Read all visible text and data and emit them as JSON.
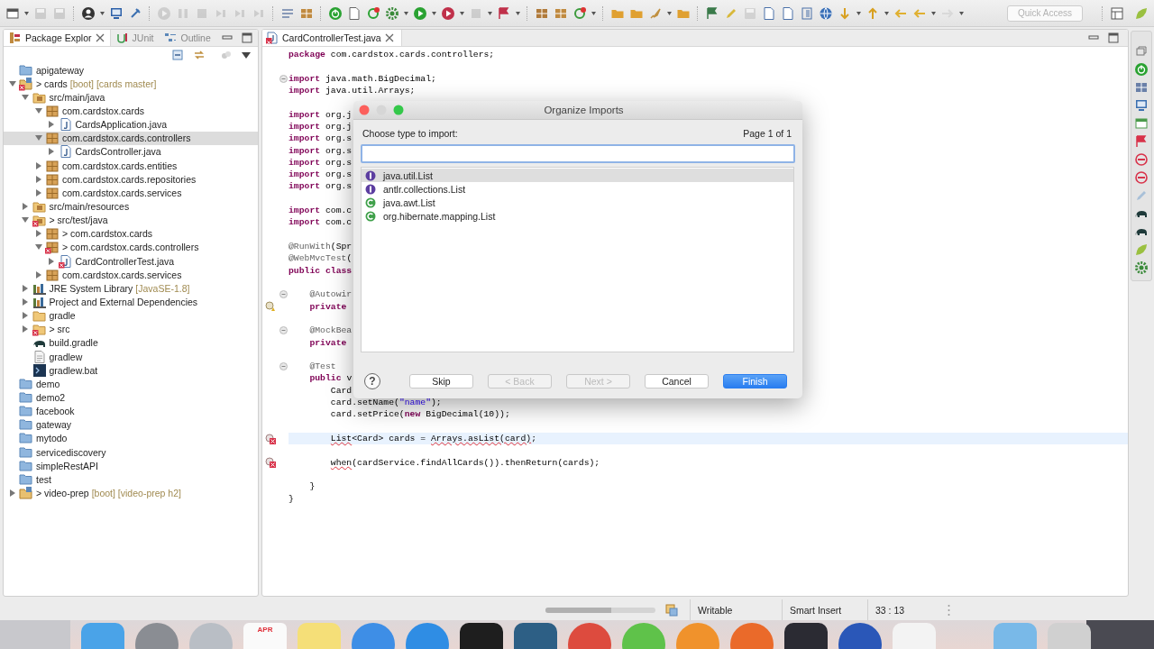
{
  "toolbar": {
    "quick_access": {
      "placeholder": "Quick Access"
    }
  },
  "explorer": {
    "tabs": [
      {
        "label": "Package Explor",
        "kind": "package",
        "selected": true
      },
      {
        "label": "JUnit",
        "kind": "junit",
        "selected": false
      },
      {
        "label": "Outline",
        "kind": "outline",
        "selected": false
      }
    ],
    "tree": [
      {
        "label": "apigateway",
        "kind": "closed-project",
        "selected": false,
        "error": false
      },
      {
        "label": "> cards",
        "suffix": "[boot] [cards master]",
        "kind": "project",
        "expanded": true,
        "selected": false,
        "error": true,
        "children": [
          {
            "label": "src/main/java",
            "kind": "source-folder",
            "expanded": true,
            "selected": false,
            "error": false,
            "children": [
              {
                "label": "com.cardstox.cards",
                "kind": "package",
                "expanded": true,
                "selected": false,
                "error": false,
                "children": [
                  {
                    "label": "CardsApplication.java",
                    "kind": "java",
                    "expanded": false,
                    "selected": false,
                    "error": false
                  }
                ]
              },
              {
                "label": "com.cardstox.cards.controllers",
                "kind": "package",
                "expanded": true,
                "selected": true,
                "error": false,
                "children": [
                  {
                    "label": "CardsController.java",
                    "kind": "java",
                    "expanded": false,
                    "selected": false,
                    "error": false
                  }
                ]
              },
              {
                "label": "com.cardstox.cards.entities",
                "kind": "package",
                "expanded": false,
                "selected": false,
                "error": false
              },
              {
                "label": "com.cardstox.cards.repositories",
                "kind": "package",
                "expanded": false,
                "selected": false,
                "error": false
              },
              {
                "label": "com.cardstox.cards.services",
                "kind": "package",
                "expanded": false,
                "selected": false,
                "error": false
              }
            ]
          },
          {
            "label": "src/main/resources",
            "kind": "source-folder",
            "expanded": false,
            "selected": false,
            "error": false
          },
          {
            "label": "> src/test/java",
            "kind": "source-folder",
            "expanded": true,
            "selected": false,
            "error": true,
            "children": [
              {
                "label": "> com.cardstox.cards",
                "kind": "package",
                "expanded": false,
                "selected": false,
                "error": false
              },
              {
                "label": "> com.cardstox.cards.controllers",
                "kind": "package",
                "expanded": true,
                "selected": false,
                "error": true,
                "children": [
                  {
                    "label": "CardControllerTest.java",
                    "kind": "java",
                    "expanded": false,
                    "selected": false,
                    "error": true
                  }
                ]
              },
              {
                "label": "com.cardstox.cards.services",
                "kind": "package",
                "expanded": false,
                "selected": false,
                "error": false
              }
            ]
          },
          {
            "label": "JRE System Library",
            "suffix": "[JavaSE-1.8]",
            "kind": "library",
            "expanded": false,
            "selected": false,
            "error": false
          },
          {
            "label": "Project and External Dependencies",
            "kind": "library",
            "expanded": false,
            "selected": false,
            "error": false
          },
          {
            "label": "gradle",
            "kind": "folder",
            "expanded": false,
            "selected": false,
            "error": false
          },
          {
            "label": "> src",
            "kind": "folder",
            "expanded": false,
            "selected": false,
            "error": true
          },
          {
            "label": "build.gradle",
            "kind": "gradle",
            "selected": false,
            "error": false
          },
          {
            "label": "gradlew",
            "kind": "file",
            "selected": false,
            "error": false
          },
          {
            "label": "gradlew.bat",
            "kind": "script",
            "selected": false,
            "error": false
          }
        ]
      },
      {
        "label": "demo",
        "kind": "closed-project",
        "selected": false,
        "error": false
      },
      {
        "label": "demo2",
        "kind": "closed-project",
        "selected": false,
        "error": false
      },
      {
        "label": "facebook",
        "kind": "closed-project",
        "selected": false,
        "error": false
      },
      {
        "label": "gateway",
        "kind": "closed-project",
        "selected": false,
        "error": false
      },
      {
        "label": "mytodo",
        "kind": "closed-project",
        "selected": false,
        "error": false
      },
      {
        "label": "servicediscovery",
        "kind": "closed-project",
        "selected": false,
        "error": false
      },
      {
        "label": "simpleRestAPI",
        "kind": "closed-project",
        "selected": false,
        "error": false
      },
      {
        "label": "test",
        "kind": "closed-project",
        "selected": false,
        "error": false
      },
      {
        "label": "> video-prep",
        "suffix": "[boot] [video-prep h2]",
        "kind": "project",
        "expanded": false,
        "selected": false,
        "error": false
      }
    ]
  },
  "editor": {
    "tab": {
      "label": "CardControllerTest.java"
    },
    "lines": [
      {
        "kind": "plain",
        "current": false,
        "spans": [
          {
            "kind": "keyword",
            "text": "package"
          },
          {
            "kind": "plain",
            "text": " com.cardstox.cards.controllers;"
          }
        ]
      },
      {
        "kind": "plain",
        "current": false
      },
      {
        "kind": "fold",
        "current": false,
        "spans": [
          {
            "kind": "keyword",
            "text": "import"
          },
          {
            "kind": "plain",
            "text": " java.math.BigDecimal;"
          }
        ]
      },
      {
        "kind": "plain",
        "current": false,
        "spans": [
          {
            "kind": "keyword",
            "text": "import"
          },
          {
            "kind": "plain",
            "text": " java.util.Arrays;"
          }
        ]
      },
      {
        "kind": "plain",
        "current": false
      },
      {
        "kind": "plain",
        "current": false,
        "spans": [
          {
            "kind": "keyword",
            "text": "import"
          },
          {
            "kind": "plain",
            "text": " org.j"
          }
        ]
      },
      {
        "kind": "plain",
        "current": false,
        "spans": [
          {
            "kind": "keyword",
            "text": "import"
          },
          {
            "kind": "plain",
            "text": " org.j"
          }
        ]
      },
      {
        "kind": "plain",
        "current": false,
        "spans": [
          {
            "kind": "keyword",
            "text": "import"
          },
          {
            "kind": "plain",
            "text": " org.s"
          }
        ]
      },
      {
        "kind": "plain",
        "current": false,
        "spans": [
          {
            "kind": "keyword",
            "text": "import"
          },
          {
            "kind": "plain",
            "text": " org.s"
          }
        ]
      },
      {
        "kind": "plain",
        "current": false,
        "spans": [
          {
            "kind": "keyword",
            "text": "import"
          },
          {
            "kind": "plain",
            "text": " org.s"
          }
        ]
      },
      {
        "kind": "plain",
        "current": false,
        "spans": [
          {
            "kind": "keyword",
            "text": "import"
          },
          {
            "kind": "plain",
            "text": " org.s"
          }
        ]
      },
      {
        "kind": "plain",
        "current": false,
        "spans": [
          {
            "kind": "keyword",
            "text": "import"
          },
          {
            "kind": "plain",
            "text": " org.s"
          }
        ]
      },
      {
        "kind": "plain",
        "current": false
      },
      {
        "kind": "plain",
        "current": false,
        "spans": [
          {
            "kind": "keyword",
            "text": "import"
          },
          {
            "kind": "plain",
            "text": " com.c"
          }
        ]
      },
      {
        "kind": "plain",
        "current": false,
        "spans": [
          {
            "kind": "keyword",
            "text": "import"
          },
          {
            "kind": "plain",
            "text": " com.c"
          }
        ]
      },
      {
        "kind": "plain",
        "current": false
      },
      {
        "kind": "plain",
        "current": false,
        "spans": [
          {
            "kind": "annotation",
            "text": "@RunWith"
          },
          {
            "kind": "plain",
            "text": "(Spr"
          }
        ]
      },
      {
        "kind": "plain",
        "current": false,
        "spans": [
          {
            "kind": "annotation",
            "text": "@WebMvcTest"
          },
          {
            "kind": "plain",
            "text": "("
          }
        ]
      },
      {
        "kind": "plain",
        "current": false,
        "spans": [
          {
            "kind": "keyword",
            "text": "public class"
          }
        ]
      },
      {
        "kind": "plain",
        "current": false
      },
      {
        "kind": "fold",
        "current": false,
        "spans": [
          {
            "kind": "annotation",
            "text": "    @Autowir"
          }
        ]
      },
      {
        "kind": "warning",
        "current": false,
        "spans": [
          {
            "kind": "keyword",
            "text": "    private"
          }
        ]
      },
      {
        "kind": "plain",
        "current": false
      },
      {
        "kind": "fold",
        "current": false,
        "spans": [
          {
            "kind": "annotation",
            "text": "    @MockBea"
          }
        ]
      },
      {
        "kind": "plain",
        "current": false,
        "spans": [
          {
            "kind": "keyword",
            "text": "    private"
          }
        ]
      },
      {
        "kind": "plain",
        "current": false
      },
      {
        "kind": "fold",
        "current": false,
        "spans": [
          {
            "kind": "annotation",
            "text": "    @Test"
          }
        ]
      },
      {
        "kind": "plain",
        "current": false,
        "spans": [
          {
            "kind": "keyword",
            "text": "    public"
          },
          {
            "kind": "plain",
            "text": " v"
          }
        ]
      },
      {
        "kind": "plain",
        "current": false,
        "spans": [
          {
            "kind": "plain",
            "text": "        Card"
          }
        ]
      },
      {
        "kind": "plain",
        "current": false,
        "spans": [
          {
            "kind": "plain",
            "text": "        card.setName("
          },
          {
            "kind": "string",
            "text": "\"name\""
          },
          {
            "kind": "plain",
            "text": ");"
          }
        ]
      },
      {
        "kind": "plain",
        "current": false,
        "spans": [
          {
            "kind": "plain",
            "text": "        card.setPrice("
          },
          {
            "kind": "keyword",
            "text": "new"
          },
          {
            "kind": "plain",
            "text": " BigDecimal(10));"
          }
        ]
      },
      {
        "kind": "plain",
        "current": false
      },
      {
        "kind": "error",
        "current": true,
        "spans": [
          {
            "kind": "error",
            "text": "        List"
          },
          {
            "kind": "plain",
            "text": "<Card> cards = "
          },
          {
            "kind": "error",
            "text": "Arrays.asList(card)"
          },
          {
            "kind": "plain",
            "text": ";"
          }
        ]
      },
      {
        "kind": "plain",
        "current": false
      },
      {
        "kind": "error",
        "current": false,
        "spans": [
          {
            "kind": "error",
            "text": "        when"
          },
          {
            "kind": "plain",
            "text": "(cardService.findAllCards()).thenReturn(cards);"
          }
        ]
      },
      {
        "kind": "plain",
        "current": false
      },
      {
        "kind": "plain",
        "current": false,
        "spans": [
          {
            "kind": "plain",
            "text": "    }"
          }
        ]
      },
      {
        "kind": "plain",
        "current": false,
        "spans": [
          {
            "kind": "plain",
            "text": "}"
          }
        ]
      }
    ]
  },
  "dialog": {
    "title": "Organize Imports",
    "prompt": "Choose type to import:",
    "page": "Page 1 of 1",
    "types": [
      {
        "label": "java.util.List",
        "kind": "interface",
        "selected": true
      },
      {
        "label": "antlr.collections.List",
        "kind": "interface",
        "selected": false
      },
      {
        "label": "java.awt.List",
        "kind": "class",
        "selected": false
      },
      {
        "label": "org.hibernate.mapping.List",
        "kind": "class",
        "selected": false
      }
    ],
    "help": "?",
    "buttons": [
      {
        "label": "Skip",
        "disabled": false,
        "default": false
      },
      {
        "label": "< Back",
        "disabled": true,
        "default": false
      },
      {
        "label": "Next >",
        "disabled": true,
        "default": false
      },
      {
        "label": "Cancel",
        "disabled": false,
        "default": false
      },
      {
        "label": "Finish",
        "disabled": false,
        "default": true
      }
    ]
  },
  "status_bar": {
    "progress": {
      "level": 0.6
    },
    "fields": [
      "Writable",
      "Smart Insert",
      "33 : 13"
    ]
  },
  "dock": [
    {
      "kind": "square",
      "color": "#4aa3e8"
    },
    {
      "kind": "round",
      "color": "#8a8d93"
    },
    {
      "kind": "round",
      "color": "#b9bec5"
    },
    {
      "kind": "calendar",
      "color": "#fafafa",
      "label": "APR"
    },
    {
      "kind": "square",
      "color": "#f5df78"
    },
    {
      "kind": "round",
      "color": "#3e8ee6"
    },
    {
      "kind": "round",
      "color": "#2f8de4"
    },
    {
      "kind": "square",
      "color": "#1e1e1e"
    },
    {
      "kind": "square",
      "color": "#2d5f85"
    },
    {
      "kind": "round",
      "color": "#dd4b3e"
    },
    {
      "kind": "round",
      "color": "#5fc24a"
    },
    {
      "kind": "round",
      "color": "#f0922c"
    },
    {
      "kind": "round",
      "color": "#ea6a2a"
    },
    {
      "kind": "square",
      "color": "#2b2b33"
    },
    {
      "kind": "round",
      "color": "#2a57b8"
    },
    {
      "kind": "square",
      "color": "#f3f3f3"
    },
    {
      "kind": "separator"
    },
    {
      "kind": "square",
      "color": "#79b9e8"
    },
    {
      "kind": "square",
      "color": "#d0d0d0"
    }
  ]
}
